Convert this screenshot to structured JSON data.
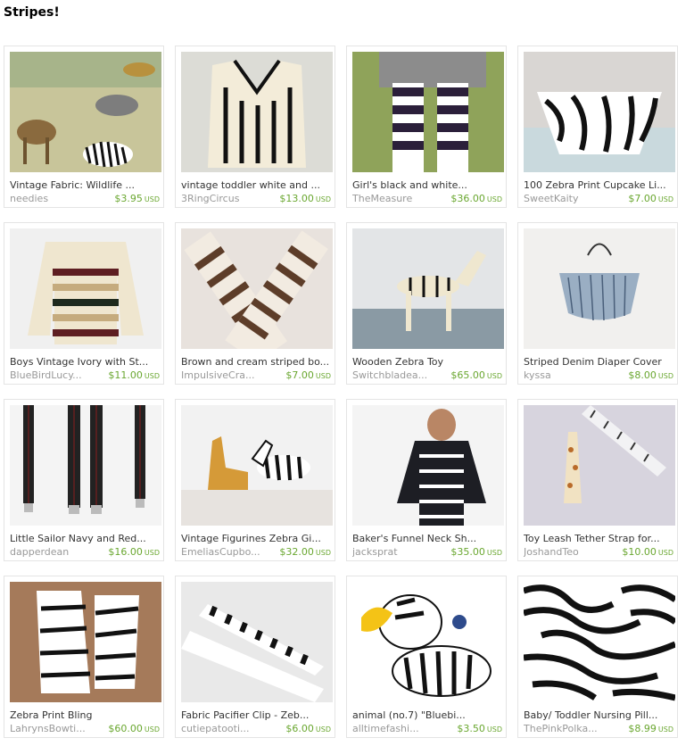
{
  "page_title": "Stripes!",
  "items": [
    {
      "name": "Vintage Fabric: Wildlife ...",
      "shop": "needies",
      "price": "$3.95",
      "currency": "USD"
    },
    {
      "name": "vintage toddler white and ...",
      "shop": "3RingCircus",
      "price": "$13.00",
      "currency": "USD"
    },
    {
      "name": "Girl's black and white...",
      "shop": "TheMeasure",
      "price": "$36.00",
      "currency": "USD"
    },
    {
      "name": "100 Zebra Print Cupcake Li...",
      "shop": "SweetKaity",
      "price": "$7.00",
      "currency": "USD"
    },
    {
      "name": "Boys Vintage Ivory with St...",
      "shop": "BlueBirdLucy...",
      "price": "$11.00",
      "currency": "USD"
    },
    {
      "name": "Brown and cream striped bo...",
      "shop": "ImpulsiveCra...",
      "price": "$7.00",
      "currency": "USD"
    },
    {
      "name": "Wooden Zebra Toy",
      "shop": "Switchbladea...",
      "price": "$65.00",
      "currency": "USD"
    },
    {
      "name": "Striped Denim Diaper Cover",
      "shop": "kyssa",
      "price": "$8.00",
      "currency": "USD"
    },
    {
      "name": "Little Sailor Navy and Red...",
      "shop": "dapperdean",
      "price": "$16.00",
      "currency": "USD"
    },
    {
      "name": "Vintage Figurines Zebra Gi...",
      "shop": "EmeliasCupbo...",
      "price": "$32.00",
      "currency": "USD"
    },
    {
      "name": "Baker's Funnel Neck Sh...",
      "shop": "jacksprat",
      "price": "$35.00",
      "currency": "USD"
    },
    {
      "name": "Toy Leash Tether Strap for...",
      "shop": "JoshandTeo",
      "price": "$10.00",
      "currency": "USD"
    },
    {
      "name": "Zebra Print Bling",
      "shop": "LahrynsBowti...",
      "price": "$60.00",
      "currency": "USD"
    },
    {
      "name": "Fabric Pacifier Clip - Zeb...",
      "shop": "cutiepatooti...",
      "price": "$6.00",
      "currency": "USD"
    },
    {
      "name": "animal (no.7) \"Bluebi...",
      "shop": "alltimefashi...",
      "price": "$3.50",
      "currency": "USD"
    },
    {
      "name": "Baby/ Toddler Nursing Pill...",
      "shop": "ThePinkPolka...",
      "price": "$8.99",
      "currency": "USD"
    }
  ],
  "image_icons": [
    "wildlife-fabric-image",
    "knit-vest-image",
    "striped-tights-image",
    "cupcake-liner-image",
    "striped-sweater-image",
    "leg-warmers-image",
    "wooden-zebra-image",
    "diaper-cover-image",
    "suspenders-image",
    "figurines-image",
    "funnel-neck-shirt-image",
    "toy-leash-image",
    "zebra-sneakers-image",
    "pacifier-clip-image",
    "zebra-print-image",
    "zebra-fabric-image"
  ],
  "colors": {
    "price": "#6aa730",
    "shop": "#999999",
    "border": "#e4e4e4"
  }
}
